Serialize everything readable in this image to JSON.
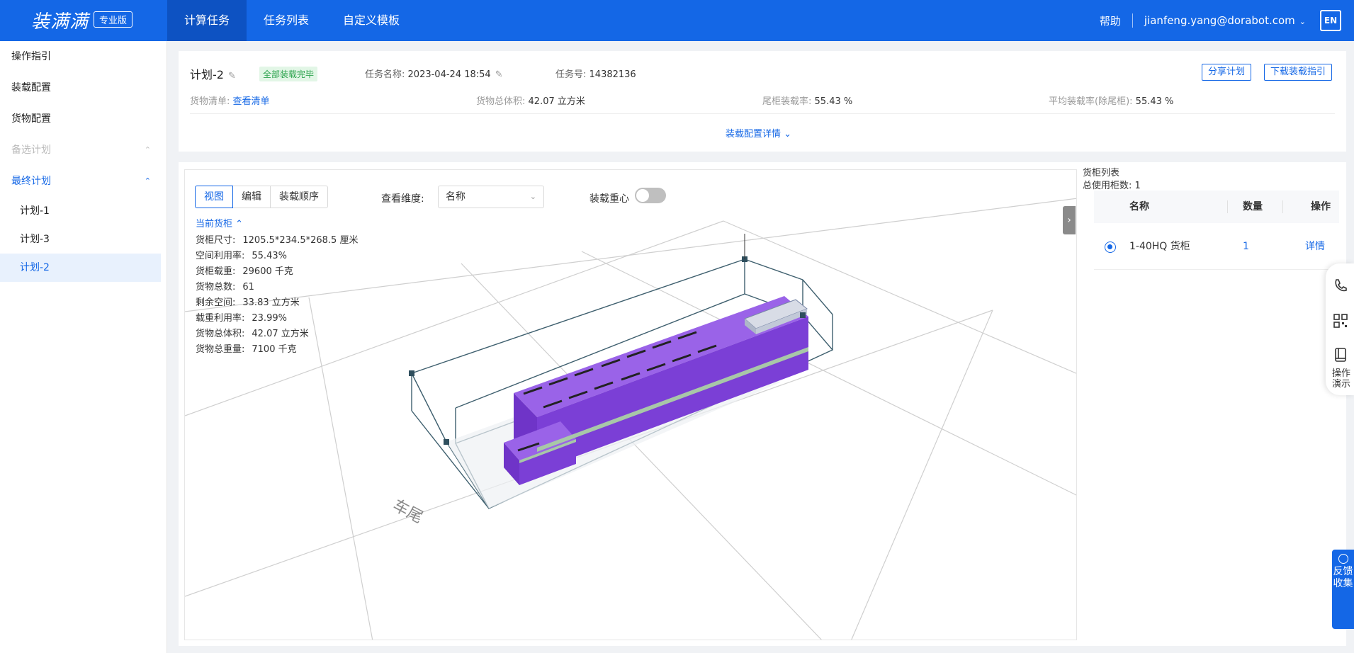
{
  "header": {
    "logo": "装满满",
    "edition": "专业版",
    "nav": [
      "计算任务",
      "任务列表",
      "自定义模板"
    ],
    "help": "帮助",
    "user": "jianfeng.yang@dorabot.com",
    "lang": "EN"
  },
  "sidebar": {
    "items": [
      "操作指引",
      "装载配置",
      "货物配置"
    ],
    "candidate": "备选计划",
    "final": "最终计划",
    "plans": [
      "计划-1",
      "计划-3",
      "计划-2"
    ]
  },
  "info": {
    "plan_title": "计划-2",
    "status_badge": "全部装载完毕",
    "task_name_label": "任务名称:",
    "task_name": "2023-04-24 18:54",
    "task_no_label": "任务号:",
    "task_no": "14382136",
    "share_btn": "分享计划",
    "download_btn": "下载装载指引",
    "cargo_list_label": "货物清单:",
    "cargo_list_link": "查看清单",
    "total_volume_label": "货物总体积:",
    "total_volume": "42.07 立方米",
    "tail_rate_label": "尾柜装载率:",
    "tail_rate": "55.43 %",
    "avg_rate_label": "平均装载率(除尾柜):",
    "avg_rate": "55.43 %",
    "detail_toggle": "装载配置详情"
  },
  "view": {
    "tabs": [
      "视图",
      "编辑",
      "装载顺序"
    ],
    "dimension_label": "查看维度:",
    "dimension_value": "名称",
    "center_label": "装载重心",
    "center_on": false,
    "current_container": "当前货柜",
    "stats": [
      {
        "label": "货柜尺寸:",
        "value": "1205.5*234.5*268.5 厘米"
      },
      {
        "label": "空间利用率:",
        "value": "55.43%"
      },
      {
        "label": "货柜载重:",
        "value": "29600 千克"
      },
      {
        "label": "货物总数:",
        "value": "61"
      },
      {
        "label": "剩余空间:",
        "value": "33.83 立方米"
      },
      {
        "label": "载重利用率:",
        "value": "23.99%"
      },
      {
        "label": "货物总体积:",
        "value": "42.07 立方米"
      },
      {
        "label": "货物总重量:",
        "value": "7100 千克"
      }
    ],
    "scene_label": "车尾",
    "cargo_color": "#7b3fd6"
  },
  "cargo": {
    "title": "货柜列表",
    "count_label": "总使用柜数:",
    "count": "1",
    "columns": [
      "名称",
      "数量",
      "操作"
    ],
    "rows": [
      {
        "name": "1-40HQ 货柜",
        "qty": "1",
        "action": "详情",
        "selected": true
      }
    ]
  },
  "float": {
    "demo_text": "操作演示",
    "feedback": "反馈收集"
  },
  "colors": {
    "primary": "#1467e6",
    "badge_bg": "#e2f6e6",
    "badge_text": "#2ea44f"
  }
}
